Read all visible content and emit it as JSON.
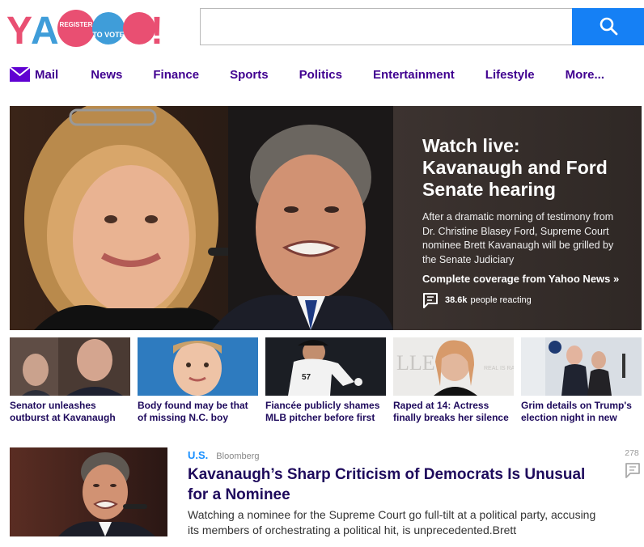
{
  "logo": {
    "brand": "YAHOO!",
    "badge_line1": "REGISTER",
    "badge_line2": "TO VOTE"
  },
  "search": {
    "value": "",
    "placeholder": "",
    "button_icon": "search-icon"
  },
  "nav": {
    "items": [
      {
        "label": "Mail",
        "icon": "mail-icon"
      },
      {
        "label": "News"
      },
      {
        "label": "Finance"
      },
      {
        "label": "Sports"
      },
      {
        "label": "Politics"
      },
      {
        "label": "Entertainment"
      },
      {
        "label": "Lifestyle"
      },
      {
        "label": "More..."
      }
    ]
  },
  "hero": {
    "title": "Watch live: Kavanaugh and Ford Senate hearing",
    "description": "After a dramatic morning of testimony from Dr. Christine Blasey Ford, Supreme Court nominee Brett Kavanaugh will be grilled by the Senate Judiciary",
    "link": "Complete coverage from Yahoo News »",
    "reactions_count": "38.6k",
    "reactions_label": "people reacting"
  },
  "thumbnails": [
    {
      "caption": "Senator unleashes outburst at Kavanaugh"
    },
    {
      "caption": "Body found may be that of missing N.C. boy"
    },
    {
      "caption": "Fiancée publicly shames MLB pitcher before first"
    },
    {
      "caption": "Raped at 14: Actress finally breaks her silence"
    },
    {
      "caption": "Grim details on Trump's election night in new"
    }
  ],
  "story": {
    "category": "U.S.",
    "source": "Bloomberg",
    "title": "Kavanaugh’s Sharp Criticism of Democrats Is Unusual for a Nominee",
    "summary": "Watching a nominee for the Supreme Court go full-tilt at a political party, accusing its members of orchestrating a political hit, is unprecedented.Brett",
    "comment_count": "278"
  },
  "colors": {
    "accent_blue": "#1580f5",
    "nav_purple": "#400090",
    "headline_navy": "#1e0a5c",
    "category_blue": "#188fff"
  }
}
